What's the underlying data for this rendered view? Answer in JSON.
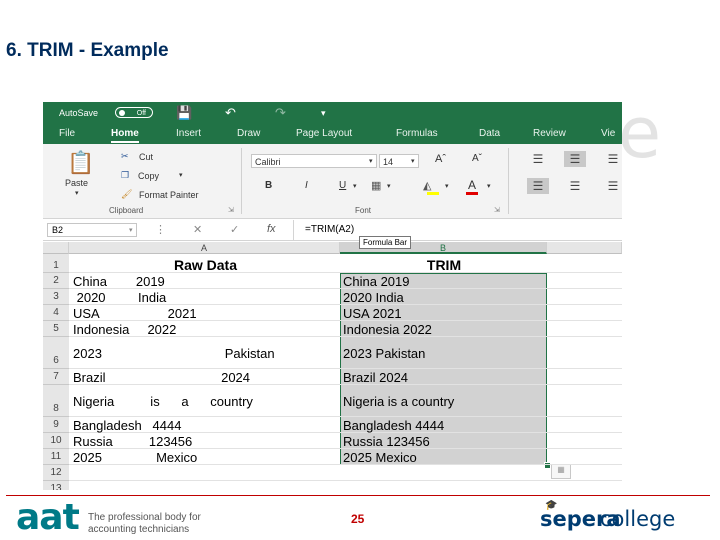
{
  "slide": {
    "title": "6. TRIM - Example",
    "page_number": "25",
    "aat_logo": "aat",
    "aat_tagline_1": "The professional body for",
    "aat_tagline_2": "accounting technicians",
    "college_logo_1": "sepera",
    "college_logo_2": "college"
  },
  "excel": {
    "autosave_label": "AutoSave",
    "autosave_state": "Off",
    "tabs": [
      "File",
      "Home",
      "Insert",
      "Draw",
      "Page Layout",
      "Formulas",
      "Data",
      "Review",
      "Vie"
    ],
    "active_tab": "Home",
    "clipboard": {
      "paste": "Paste",
      "cut": "Cut",
      "copy": "Copy",
      "format_painter": "Format Painter",
      "group_label": "Clipboard"
    },
    "font": {
      "name": "Calibri",
      "size": "14",
      "bold": "B",
      "italic": "I",
      "underline": "U",
      "group_label": "Font"
    },
    "formula_bar": {
      "name_box": "B2",
      "fx": "fx",
      "formula": "=TRIM(A2)",
      "tooltip": "Formula Bar"
    },
    "columns": [
      "A",
      "B"
    ],
    "rows": [
      {
        "num": "1",
        "a": "Raw Data",
        "b": "TRIM"
      },
      {
        "num": "2",
        "a": "China        2019",
        "b": "China 2019"
      },
      {
        "num": "3",
        "a": " 2020         India",
        "b": "2020 India"
      },
      {
        "num": "4",
        "a": "USA                   2021",
        "b": "USA 2021"
      },
      {
        "num": "5",
        "a": "Indonesia     2022",
        "b": "Indonesia 2022"
      },
      {
        "num": "6",
        "a": "2023                                  Pakistan",
        "b": "2023 Pakistan"
      },
      {
        "num": "7",
        "a": "Brazil                                2024",
        "b": "Brazil 2024"
      },
      {
        "num": "8",
        "a": "Nigeria          is      a      country",
        "b": "Nigeria is a country"
      },
      {
        "num": "9",
        "a": "Bangladesh   4444",
        "b": "Bangladesh 4444"
      },
      {
        "num": "10",
        "a": "Russia          123456",
        "b": "Russia 123456"
      },
      {
        "num": "11",
        "a": "2025               Mexico",
        "b": "2025 Mexico"
      },
      {
        "num": "12",
        "a": "",
        "b": ""
      },
      {
        "num": "13",
        "a": "",
        "b": ""
      }
    ]
  },
  "icons": [
    "save-icon",
    "undo-icon",
    "redo-icon",
    "cut-icon",
    "copy-icon",
    "format-painter-icon",
    "paste-icon"
  ]
}
